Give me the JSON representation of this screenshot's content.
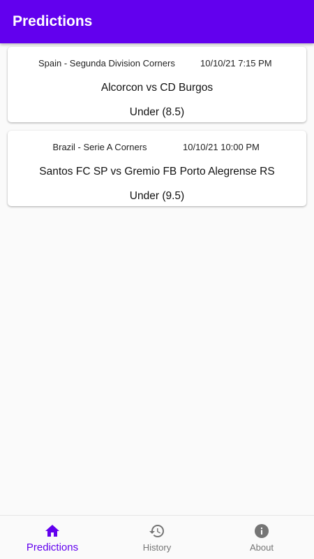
{
  "app_bar": {
    "title": "Predictions"
  },
  "colors": {
    "primary": "#6200ee",
    "inactive": "#757575"
  },
  "predictions": [
    {
      "league": "Spain - Segunda Division Corners",
      "datetime": "10/10/21 7:15 PM",
      "match": "Alcorcon vs CD Burgos",
      "prediction": "Under (8.5)"
    },
    {
      "league": "Brazil - Serie A Corners",
      "datetime": "10/10/21 10:00 PM",
      "match": "Santos FC SP vs Gremio FB Porto Alegrense RS",
      "prediction": "Under (9.5)"
    }
  ],
  "bottom_nav": {
    "items": [
      {
        "label": "Predictions",
        "icon": "home-icon",
        "active": true
      },
      {
        "label": "History",
        "icon": "history-icon",
        "active": false
      },
      {
        "label": "About",
        "icon": "info-icon",
        "active": false
      }
    ]
  }
}
